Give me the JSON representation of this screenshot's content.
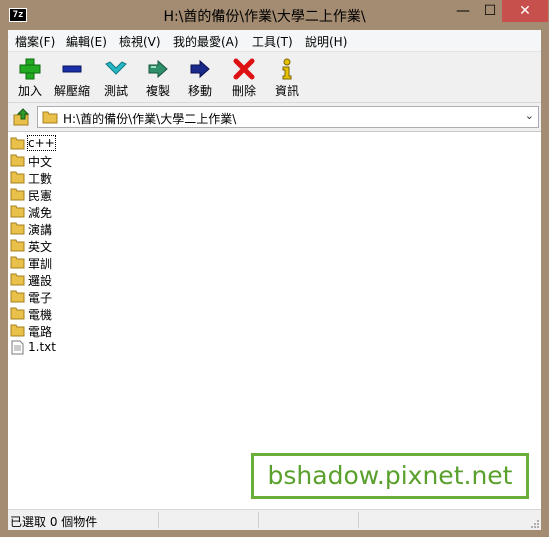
{
  "window": {
    "title": "H:\\酋的備份\\作業\\大學二上作業\\",
    "app_icon_text": "7z",
    "minimize_glyph": "—",
    "maximize_glyph": "☐",
    "close_glyph": "✕",
    "close_color": "#c7504d"
  },
  "menu": {
    "items": [
      {
        "label": "檔案(F)"
      },
      {
        "label": "編輯(E)"
      },
      {
        "label": "檢視(V)"
      },
      {
        "label": "我的最愛(A)"
      },
      {
        "label": "工具(T)"
      },
      {
        "label": "說明(H)"
      }
    ]
  },
  "toolbar": {
    "buttons": [
      {
        "label": "加入",
        "icon": "plus-icon",
        "color": "#22aa22"
      },
      {
        "label": "解壓縮",
        "icon": "minus-icon",
        "color": "#1a2fa8"
      },
      {
        "label": "測試",
        "icon": "check-chevron-icon",
        "color": "#26b7c4"
      },
      {
        "label": "複製",
        "icon": "copy-arrow-icon",
        "color": "#2f8f6a"
      },
      {
        "label": "移動",
        "icon": "arrow-right-icon",
        "color": "#1a2a8a"
      },
      {
        "label": "刪除",
        "icon": "delete-x-icon",
        "color": "#dd1111"
      },
      {
        "label": "資訊",
        "icon": "info-icon",
        "color": "#e6c200"
      }
    ]
  },
  "address": {
    "path": "H:\\酋的備份\\作業\\大學二上作業\\",
    "up_icon": "folder-up-icon",
    "dropdown_icon": "chevron-down-icon"
  },
  "files": [
    {
      "name": "c++",
      "type": "folder"
    },
    {
      "name": "中文",
      "type": "folder"
    },
    {
      "name": "工數",
      "type": "folder"
    },
    {
      "name": "民憲",
      "type": "folder"
    },
    {
      "name": "減免",
      "type": "folder"
    },
    {
      "name": "演講",
      "type": "folder"
    },
    {
      "name": "英文",
      "type": "folder"
    },
    {
      "name": "軍訓",
      "type": "folder"
    },
    {
      "name": "邏設",
      "type": "folder"
    },
    {
      "name": "電子",
      "type": "folder"
    },
    {
      "name": "電機",
      "type": "folder"
    },
    {
      "name": "電路",
      "type": "folder"
    },
    {
      "name": "1.txt",
      "type": "file"
    }
  ],
  "status": {
    "text": "已選取 0 個物件"
  },
  "watermark": {
    "text": "bshadow.pixnet.net",
    "border_color": "#6aaf3a",
    "text_color": "#5aa02c"
  },
  "colors": {
    "frame": "#a38c72",
    "folder": "#e8c04a"
  }
}
